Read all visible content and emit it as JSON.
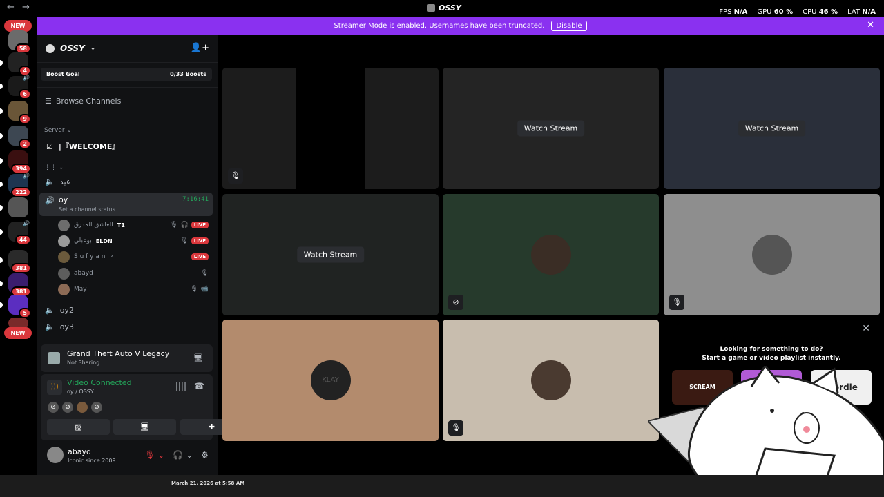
{
  "titlebar": {
    "title": "OSSY",
    "back": "←",
    "forward": "→"
  },
  "stats": {
    "fps_label": "FPS",
    "fps": "N/A",
    "gpu_label": "GPU",
    "gpu": "60 %",
    "cpu_label": "CPU",
    "cpu": "46 %",
    "lat_label": "LAT",
    "lat": "N/A"
  },
  "rail": {
    "new_label": "NEW",
    "badges": [
      "58",
      "4",
      "6",
      "9",
      "2",
      "394",
      "222",
      "44",
      "381",
      "381",
      "5"
    ]
  },
  "banner": {
    "text": "Streamer Mode is enabled. Usernames have been truncated.",
    "button": "Disable"
  },
  "guild": {
    "name": "OSSY"
  },
  "boost": {
    "label": "Boost Goal",
    "value": "0/33 Boosts"
  },
  "browse": {
    "label": "Browse Channels"
  },
  "sections": {
    "server": "Server",
    "unnamed": "⋮⋮"
  },
  "channels": {
    "welcome": "|『WELCOME』",
    "eid": "عيد",
    "oy": "oy",
    "oy_timer": "7:16:41",
    "oy_status": "Set a channel status",
    "oy2": "oy2",
    "oy3": "oy3"
  },
  "voice_users": [
    {
      "name": "العاشق المدرق",
      "tag": "T1",
      "live": "LIVE"
    },
    {
      "name": "بوعبلي",
      "tag": "ELDN",
      "live": "LIVE"
    },
    {
      "name": "S u f y a n i ‹",
      "tag": "",
      "live": "LIVE"
    },
    {
      "name": "abayd",
      "tag": "",
      "live": ""
    },
    {
      "name": "May",
      "tag": "",
      "live": ""
    }
  ],
  "game": {
    "title": "Grand Theft Auto V Legacy",
    "status": "Not Sharing"
  },
  "voice": {
    "status": "Video Connected",
    "channel": "oy / OSSY"
  },
  "user": {
    "name": "abayd",
    "status": "Iconic since 2009"
  },
  "tiles": {
    "watch": "Watch Stream"
  },
  "tile_face_label": "KLAY",
  "activity": {
    "line1": "Looking for something to do?",
    "line2": "Start a game or video playlist instantly.",
    "scream": "SCREAM",
    "wordle": "Wordle"
  },
  "strip": {
    "date": "March 21, 2026 at 5:58 AM"
  },
  "colors": {
    "accent": "#8a31f0",
    "live": "#da373c",
    "green": "#23a55a"
  }
}
